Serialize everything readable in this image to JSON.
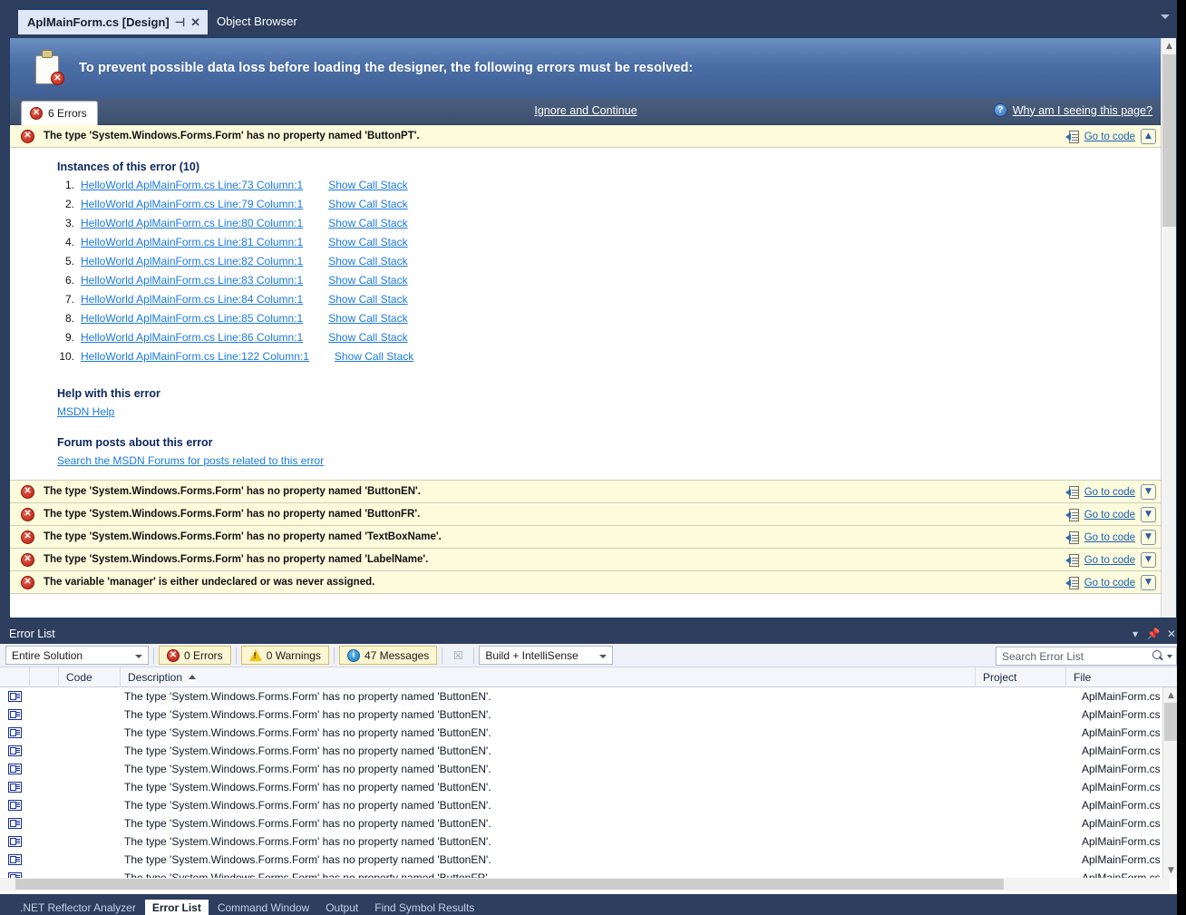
{
  "window": {
    "tabs": [
      {
        "title": "AplMainForm.cs [Design]",
        "active": true,
        "pin_icon": "pin-icon",
        "close_icon": "close-icon"
      },
      {
        "title": "Object Browser",
        "active": false
      }
    ],
    "tabbar_overflow_icon": "chevron-down-icon"
  },
  "designer": {
    "banner_icon": "clipboard-error-icon",
    "banner_text": "To prevent possible data loss before loading the designer, the following errors must be resolved:",
    "errors_tab_label": "6 Errors",
    "ignore_link": "Ignore and Continue",
    "why_link": "Why am I seeing this page?",
    "why_icon": "question-circle-icon",
    "goto_label": "Go to code",
    "goto_icon": "go-to-code-icon",
    "collapse_icon": "chevron-double-up-icon",
    "expand_icon": "chevron-double-down-icon",
    "errors": [
      {
        "text": "The type 'System.Windows.Forms.Form' has no property named 'ButtonPT'.",
        "expanded": true
      },
      {
        "text": "The type 'System.Windows.Forms.Form' has no property named 'ButtonEN'.",
        "expanded": false
      },
      {
        "text": "The type 'System.Windows.Forms.Form' has no property named 'ButtonFR'.",
        "expanded": false
      },
      {
        "text": "The type 'System.Windows.Forms.Form' has no property named 'TextBoxName'.",
        "expanded": false
      },
      {
        "text": "The type 'System.Windows.Forms.Form' has no property named 'LabelName'.",
        "expanded": false
      },
      {
        "text": "The variable 'manager' is either undeclared or was never assigned.",
        "expanded": false
      }
    ],
    "detail": {
      "instances_heading": "Instances of this error (10)",
      "show_call_stack_label": "Show Call Stack",
      "instances": [
        {
          "num": "1.",
          "link": "HelloWorld AplMainForm.cs Line:73 Column:1"
        },
        {
          "num": "2.",
          "link": "HelloWorld AplMainForm.cs Line:79 Column:1"
        },
        {
          "num": "3.",
          "link": "HelloWorld AplMainForm.cs Line:80 Column:1"
        },
        {
          "num": "4.",
          "link": "HelloWorld AplMainForm.cs Line:81 Column:1"
        },
        {
          "num": "5.",
          "link": "HelloWorld AplMainForm.cs Line:82 Column:1"
        },
        {
          "num": "6.",
          "link": "HelloWorld AplMainForm.cs Line:83 Column:1"
        },
        {
          "num": "7.",
          "link": "HelloWorld AplMainForm.cs Line:84 Column:1"
        },
        {
          "num": "8.",
          "link": "HelloWorld AplMainForm.cs Line:85 Column:1"
        },
        {
          "num": "9.",
          "link": "HelloWorld AplMainForm.cs Line:86 Column:1"
        },
        {
          "num": "10.",
          "link": "HelloWorld AplMainForm.cs Line:122 Column:1"
        }
      ],
      "help_heading": "Help with this error",
      "help_link": "MSDN Help",
      "forum_heading": "Forum posts about this error",
      "forum_link": "Search the MSDN Forums for posts related to this error"
    },
    "scroll_up_icon": "scroll-up-arrow-icon"
  },
  "error_list": {
    "title": "Error List",
    "title_buttons": {
      "dropdown_icon": "chevron-down-icon",
      "pin_icon": "pin-icon",
      "close_icon": "close-icon"
    },
    "scope_selector": "Entire Solution",
    "errors_toggle": "0 Errors",
    "warnings_toggle": "0 Warnings",
    "messages_toggle": "47 Messages",
    "clear_filter_icon": "clear-filter-icon",
    "build_selector": "Build + IntelliSense",
    "search_placeholder": "Search Error List",
    "search_value": "",
    "search_icon": "search-icon",
    "columns": [
      "",
      "",
      "Code",
      "Description",
      "Project",
      "File"
    ],
    "sort_column": "Description",
    "sort_direction": "asc",
    "row_icon": "message-icon",
    "rows": [
      {
        "code": "",
        "description": "The type 'System.Windows.Forms.Form' has no property named 'ButtonEN'.",
        "project": "",
        "file": "AplMainForm.cs"
      },
      {
        "code": "",
        "description": "The type 'System.Windows.Forms.Form' has no property named 'ButtonEN'.",
        "project": "",
        "file": "AplMainForm.cs"
      },
      {
        "code": "",
        "description": "The type 'System.Windows.Forms.Form' has no property named 'ButtonEN'.",
        "project": "",
        "file": "AplMainForm.cs"
      },
      {
        "code": "",
        "description": "The type 'System.Windows.Forms.Form' has no property named 'ButtonEN'.",
        "project": "",
        "file": "AplMainForm.cs"
      },
      {
        "code": "",
        "description": "The type 'System.Windows.Forms.Form' has no property named 'ButtonEN'.",
        "project": "",
        "file": "AplMainForm.cs"
      },
      {
        "code": "",
        "description": "The type 'System.Windows.Forms.Form' has no property named 'ButtonEN'.",
        "project": "",
        "file": "AplMainForm.cs"
      },
      {
        "code": "",
        "description": "The type 'System.Windows.Forms.Form' has no property named 'ButtonEN'.",
        "project": "",
        "file": "AplMainForm.cs"
      },
      {
        "code": "",
        "description": "The type 'System.Windows.Forms.Form' has no property named 'ButtonEN'.",
        "project": "",
        "file": "AplMainForm.cs"
      },
      {
        "code": "",
        "description": "The type 'System.Windows.Forms.Form' has no property named 'ButtonEN'.",
        "project": "",
        "file": "AplMainForm.cs"
      },
      {
        "code": "",
        "description": "The type 'System.Windows.Forms.Form' has no property named 'ButtonEN'.",
        "project": "",
        "file": "AplMainForm.cs"
      },
      {
        "code": "",
        "description": "The type 'System.Windows.Forms.Form' has no property named 'ButtonFR'.",
        "project": "",
        "file": "AplMainForm.cs"
      }
    ]
  },
  "bottom_tabs": [
    {
      "label": ".NET Reflector Analyzer",
      "active": false
    },
    {
      "label": "Error List",
      "active": true
    },
    {
      "label": "Command Window",
      "active": false
    },
    {
      "label": "Output",
      "active": false
    },
    {
      "label": "Find Symbol Results",
      "active": false
    }
  ]
}
